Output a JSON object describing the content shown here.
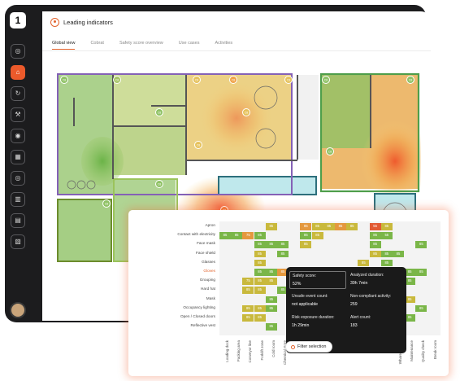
{
  "app": {
    "logo_text": "1",
    "page_title": "Leading indicators"
  },
  "tabs": [
    {
      "label": "Global view",
      "active": true
    },
    {
      "label": "Cobrat",
      "active": false
    },
    {
      "label": "Safety score overview",
      "active": false
    },
    {
      "label": "Use cases",
      "active": false
    },
    {
      "label": "Activities",
      "active": false
    }
  ],
  "sidebar": {
    "icons": [
      "dashboard-icon",
      "home-icon",
      "refresh-icon",
      "hammer-icon",
      "globe-icon",
      "chart-icon",
      "target-icon",
      "buildings-icon",
      "document-icon",
      "report-icon"
    ],
    "active_index": 1
  },
  "floorplan": {
    "zone_marker_label": "C8"
  },
  "heatmap": {
    "rows": [
      "Apron",
      "Contact with electricity",
      "Face mask",
      "Face shield",
      "Glasses",
      "Gloves",
      "Grouping",
      "Hard hat",
      "Mask",
      "Occupancy lighting",
      "Open / Closed doors",
      "Reflective vest"
    ],
    "highlight_row": "Gloves",
    "columns": [
      "Loading dock",
      "Packing area",
      "Conveyor line",
      "Forklift zone",
      "Cold room",
      "Chemical store",
      "",
      "",
      "",
      "",
      "",
      "",
      "",
      "",
      "",
      "Wharehouse 1",
      "Maintenance",
      "Quality check",
      "Break room"
    ],
    "cells": [
      [
        0,
        4,
        "85",
        "y"
      ],
      [
        0,
        7,
        "85",
        "o"
      ],
      [
        0,
        8,
        "85",
        "y"
      ],
      [
        0,
        9,
        "85",
        "y"
      ],
      [
        0,
        10,
        "85",
        "o"
      ],
      [
        0,
        11,
        "85",
        "y"
      ],
      [
        0,
        13,
        "55",
        "r"
      ],
      [
        0,
        14,
        "85",
        "y"
      ],
      [
        1,
        0,
        "85",
        "g"
      ],
      [
        1,
        1,
        "85",
        "g"
      ],
      [
        1,
        2,
        "75",
        "o"
      ],
      [
        1,
        3,
        "85",
        "g"
      ],
      [
        1,
        7,
        "85",
        "g"
      ],
      [
        1,
        8,
        "85",
        "y"
      ],
      [
        1,
        13,
        "85",
        "g"
      ],
      [
        1,
        14,
        "55",
        "g"
      ],
      [
        2,
        3,
        "85",
        "g"
      ],
      [
        2,
        4,
        "85",
        "g"
      ],
      [
        2,
        5,
        "85",
        "g"
      ],
      [
        2,
        7,
        "85",
        "y"
      ],
      [
        2,
        13,
        "85",
        "g"
      ],
      [
        2,
        17,
        "85",
        "g"
      ],
      [
        3,
        3,
        "85",
        "y"
      ],
      [
        3,
        5,
        "85",
        "g"
      ],
      [
        3,
        13,
        "85",
        "y"
      ],
      [
        3,
        14,
        "85",
        "g"
      ],
      [
        3,
        15,
        "85",
        "g"
      ],
      [
        4,
        3,
        "85",
        "y"
      ],
      [
        4,
        12,
        "85",
        "y"
      ],
      [
        4,
        14,
        "85",
        "g"
      ],
      [
        5,
        3,
        "85",
        "g"
      ],
      [
        5,
        4,
        "85",
        "g"
      ],
      [
        5,
        5,
        "85",
        "o"
      ],
      [
        5,
        16,
        "85",
        "g"
      ],
      [
        5,
        17,
        "85",
        "g"
      ],
      [
        6,
        2,
        "75",
        "y"
      ],
      [
        6,
        3,
        "85",
        "y"
      ],
      [
        6,
        4,
        "85",
        "y"
      ],
      [
        6,
        16,
        "85",
        "g"
      ],
      [
        7,
        2,
        "85",
        "y"
      ],
      [
        7,
        3,
        "85",
        "y"
      ],
      [
        7,
        5,
        "85",
        "g"
      ],
      [
        8,
        4,
        "85",
        "g"
      ],
      [
        8,
        16,
        "85",
        "y"
      ],
      [
        9,
        2,
        "85",
        "y"
      ],
      [
        9,
        3,
        "85",
        "y"
      ],
      [
        9,
        4,
        "85",
        "g"
      ],
      [
        9,
        17,
        "85",
        "g"
      ],
      [
        10,
        2,
        "85",
        "y"
      ],
      [
        10,
        3,
        "85",
        "y"
      ],
      [
        10,
        16,
        "85",
        "g"
      ],
      [
        11,
        4,
        "85",
        "g"
      ]
    ]
  },
  "tooltip": {
    "items": [
      {
        "label": "Safety score:",
        "value": "52%"
      },
      {
        "label": "Analyzed duration:",
        "value": "39h 7min"
      },
      {
        "label": "Unsafe event count:",
        "value": "not applicable"
      },
      {
        "label": "Non-compliant activity:",
        "value": "259"
      },
      {
        "label": "Risk exposure duration:",
        "value": "1h 29min"
      },
      {
        "label": "Alert count:",
        "value": "183"
      }
    ],
    "filter_label": "Filter selection"
  },
  "colors": {
    "accent": "#e2632d",
    "good": "#7ab648",
    "ok": "#c9b93c",
    "warn": "#e4983e",
    "bad": "#e25a33"
  }
}
